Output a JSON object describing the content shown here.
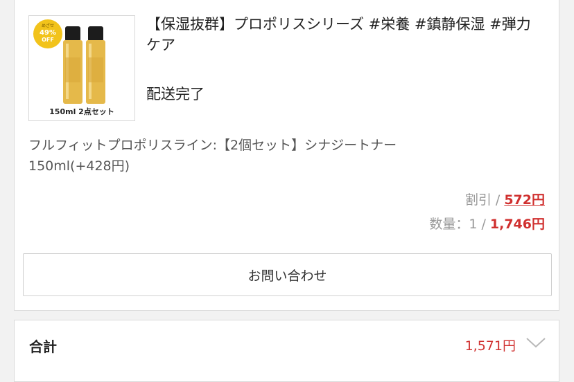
{
  "product": {
    "thumb_badge": "めざせ 49% OFF",
    "thumb_caption": "150ml 2点セット",
    "title": "【保湿抜群】プロポリスシリーズ #栄養 #鎮静保湿 #弾力ケア",
    "status": "配送完了",
    "option_line1": "フルフィットプロポリスライン:【2個セット】シナジートナー",
    "option_line2": "150ml(+428円)",
    "discount_label": "割引 / ",
    "discount_amount": "572円",
    "qty_label": "数量：1 / ",
    "qty_amount": "1,746円",
    "inquiry_button": "お問い合わせ"
  },
  "total": {
    "label": "合計",
    "amount": "1,571円",
    "chevron_icon": "chevron-down-icon"
  },
  "colors": {
    "price_red": "#d0302f",
    "badge_yellow": "#f2c31b",
    "bottle_gold": "#e5b94a"
  }
}
